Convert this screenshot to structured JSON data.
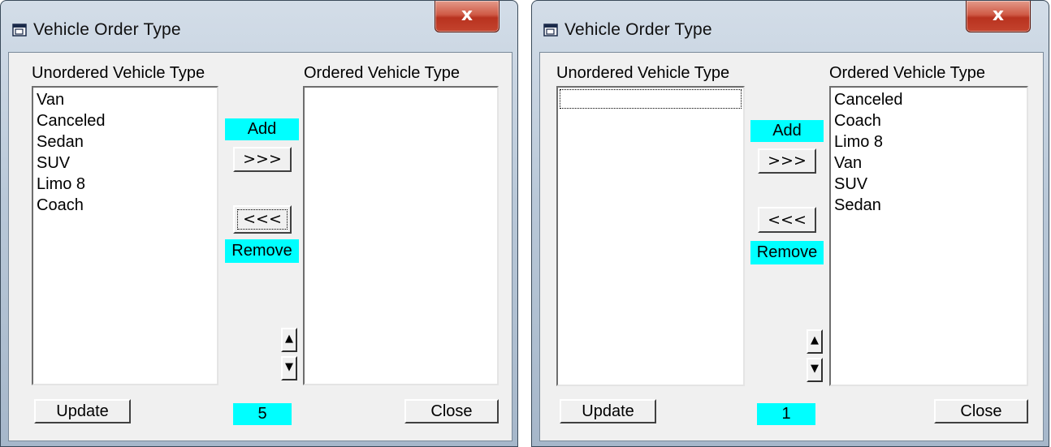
{
  "panels": [
    {
      "title": "Vehicle Order Type",
      "close_glyph": "x",
      "unordered_label": "Unordered Vehicle Type",
      "ordered_label": "Ordered Vehicle Type",
      "unordered_items": [
        "Van",
        "Canceled",
        "Sedan",
        "SUV",
        "Limo 8",
        "Coach"
      ],
      "ordered_items": [],
      "add_label": "Add",
      "add_button": ">>>",
      "remove_button": "<<<",
      "remove_label": "Remove",
      "spin_up": "▲",
      "spin_down": "▼",
      "update_button": "Update",
      "count": "5",
      "close_button": "Close"
    },
    {
      "title": "Vehicle Order Type",
      "close_glyph": "x",
      "unordered_label": "Unordered Vehicle Type",
      "ordered_label": "Ordered Vehicle Type",
      "unordered_items": [],
      "ordered_items": [
        "Canceled",
        "Coach",
        "Limo 8",
        "Van",
        "SUV",
        "Sedan"
      ],
      "add_label": "Add",
      "add_button": ">>>",
      "remove_button": "<<<",
      "remove_label": "Remove",
      "spin_up": "▲",
      "spin_down": "▼",
      "update_button": "Update",
      "count": "1",
      "close_button": "Close"
    }
  ],
  "colors": {
    "accent_cyan": "#00ffff",
    "window_frame": "#b9c8d8",
    "close_red": "#c4442e",
    "dialog_bg": "#f0f0f0"
  },
  "icons": {
    "app": "window-app-icon",
    "close": "close-icon",
    "up": "arrow-up-icon",
    "down": "arrow-down-icon"
  }
}
